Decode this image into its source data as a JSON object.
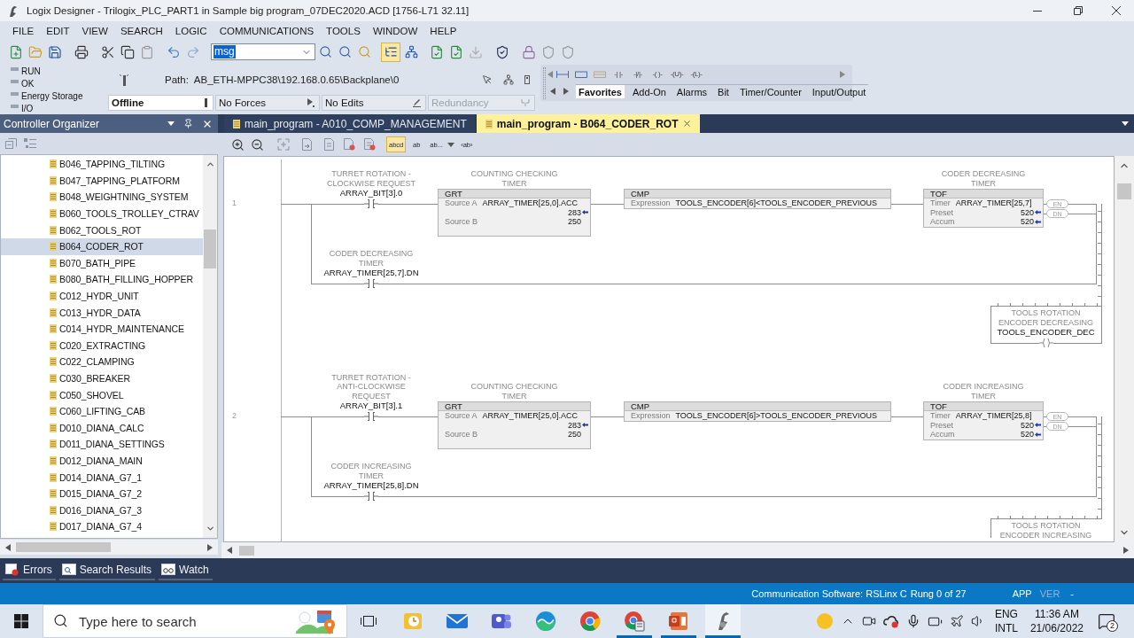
{
  "window": {
    "title": "Logix Designer - Trilogix_PLC_PART1 in Sample big program_07DEC2020.ACD [1756-L71 32.11]"
  },
  "menu": [
    "FILE",
    "EDIT",
    "VIEW",
    "SEARCH",
    "LOGIC",
    "COMMUNICATIONS",
    "TOOLS",
    "WINDOW",
    "HELP"
  ],
  "toolbar": {
    "search": {
      "value": "msg",
      "highlighted": true
    },
    "view_toggles": [
      {
        "selected": true
      },
      {
        "selected": false
      }
    ]
  },
  "controller_status": {
    "indicators": [
      {
        "label": "RUN",
        "on": false
      },
      {
        "label": "OK",
        "on": false
      },
      {
        "label": "Energy Storage",
        "on": false
      },
      {
        "label": "I/O",
        "on": false
      }
    ],
    "path_label": "Path:",
    "path": "AB_ETH-MPPC38\\192.168.0.65\\Backplane\\0",
    "modes": [
      {
        "kind": "dropdown",
        "label": "Offline",
        "disabled": false
      },
      {
        "kind": "status",
        "label": "No Forces",
        "disabled": false
      },
      {
        "kind": "status",
        "label": "No Edits",
        "disabled": false
      },
      {
        "kind": "status",
        "label": "Redundancy",
        "disabled": true
      }
    ]
  },
  "instruction_palette": {
    "symbols": [
      "-| |-",
      "-|/|-",
      "-( )-",
      "-(U)-",
      "-(L)-"
    ],
    "tabs": [
      {
        "label": "Favorites",
        "selected": true
      },
      {
        "label": "Add-On",
        "selected": false
      },
      {
        "label": "Alarms",
        "selected": false
      },
      {
        "label": "Bit",
        "selected": false
      },
      {
        "label": "Timer/Counter",
        "selected": false
      },
      {
        "label": "Input/Output",
        "selected": false
      }
    ]
  },
  "organizer": {
    "title": "Controller Organizer",
    "items": [
      {
        "label": "B046_TAPPING_TILTING",
        "selected": false
      },
      {
        "label": "B047_TAPPING_PLATFORM",
        "selected": false
      },
      {
        "label": "B048_WEIGHTNING_SYSTEM",
        "selected": false
      },
      {
        "label": "B060_TOOLS_TROLLEY_CTRAV",
        "selected": false
      },
      {
        "label": "B062_TOOLS_ROT",
        "selected": false
      },
      {
        "label": "B064_CODER_ROT",
        "selected": true
      },
      {
        "label": "B070_BATH_PIPE",
        "selected": false
      },
      {
        "label": "B080_BATH_FILLING_HOPPER",
        "selected": false
      },
      {
        "label": "C012_HYDR_UNIT",
        "selected": false
      },
      {
        "label": "C013_HYDR_DATA",
        "selected": false
      },
      {
        "label": "C014_HYDR_MAINTENANCE",
        "selected": false
      },
      {
        "label": "C020_EXTRACTING",
        "selected": false
      },
      {
        "label": "C022_CLAMPING",
        "selected": false
      },
      {
        "label": "C030_BREAKER",
        "selected": false
      },
      {
        "label": "C050_SHOVEL",
        "selected": false
      },
      {
        "label": "C060_LIFTING_CAB",
        "selected": false
      },
      {
        "label": "D010_DIANA_CALC",
        "selected": false
      },
      {
        "label": "D011_DIANA_SETTINGS",
        "selected": false
      },
      {
        "label": "D012_DIANA_MAIN",
        "selected": false
      },
      {
        "label": "D014_DIANA_G7_1",
        "selected": false
      },
      {
        "label": "D015_DIANA_G7_2",
        "selected": false
      },
      {
        "label": "D016_DIANA_G7_3",
        "selected": false
      },
      {
        "label": "D017_DIANA_G7_4",
        "selected": false
      }
    ]
  },
  "document_tabs": [
    {
      "label": "main_program - A010_COMP_MANAGEMENT",
      "selected": false
    },
    {
      "label": "main_program - B064_CODER_ROT",
      "selected": true
    }
  ],
  "ladder_toolbar": {
    "text_buttons": [
      {
        "kind": "toggle",
        "label": "abcd",
        "selected": true
      },
      {
        "kind": "toggle",
        "label": "ab",
        "selected": false
      },
      {
        "kind": "dropdown",
        "label": "ab...",
        "selected": false
      },
      {
        "kind": "toggle",
        "label": "‹ab›",
        "selected": false
      }
    ]
  },
  "rungs": [
    {
      "number": "1",
      "input": {
        "description": "TURRET ROTATION - CLOCKWISE REQUEST",
        "tag": "ARRAY_BIT[3].0"
      },
      "instructions": [
        {
          "description": "COUNTING CHECKING TIMER",
          "mnemonic": "GRT",
          "operands": [
            {
              "label": "Source A",
              "tag": "ARRAY_TIMER[25,0].ACC",
              "value": "283",
              "live": true
            },
            {
              "label": "Source B",
              "value": "250",
              "live": false
            }
          ]
        },
        {
          "mnemonic": "CMP",
          "operands": [
            {
              "label": "Expression",
              "tag": "TOOLS_ENCODER[6]<TOOLS_ENCODER_PREVIOUS"
            }
          ]
        },
        {
          "description": "CODER DECREASING TIMER",
          "mnemonic": "TOF",
          "operands": [
            {
              "label": "Timer",
              "tag": "ARRAY_TIMER[25,7]"
            },
            {
              "label": "Preset",
              "value": "520",
              "live": true
            },
            {
              "label": "Accum",
              "value": "520",
              "live": true
            }
          ],
          "outputs": [
            "EN",
            "DN"
          ]
        }
      ],
      "branch": {
        "description": "CODER DECREASING TIMER",
        "tag": "ARRAY_TIMER[25,7].DN"
      },
      "output": {
        "description": "TOOLS ROTATION ENCODER DECREASING",
        "tag": "TOOLS_ENCODER_DEC"
      }
    },
    {
      "number": "2",
      "input": {
        "description": "TURRET ROTATION - ANTI-CLOCKWISE REQUEST",
        "tag": "ARRAY_BIT[3].1"
      },
      "instructions": [
        {
          "description": "COUNTING CHECKING TIMER",
          "mnemonic": "GRT",
          "operands": [
            {
              "label": "Source A",
              "tag": "ARRAY_TIMER[25,0].ACC",
              "value": "283",
              "live": true
            },
            {
              "label": "Source B",
              "value": "250",
              "live": false
            }
          ]
        },
        {
          "mnemonic": "CMP",
          "operands": [
            {
              "label": "Expression",
              "tag": "TOOLS_ENCODER[6]>TOOLS_ENCODER_PREVIOUS"
            }
          ]
        },
        {
          "description": "CODER INCREASING TIMER",
          "mnemonic": "TOF",
          "operands": [
            {
              "label": "Timer",
              "tag": "ARRAY_TIMER[25,8]"
            },
            {
              "label": "Preset",
              "value": "520",
              "live": true
            },
            {
              "label": "Accum",
              "value": "520",
              "live": true
            }
          ],
          "outputs": [
            "EN",
            "DN"
          ]
        }
      ],
      "branch": {
        "description": "CODER INCREASING TIMER",
        "tag": "ARRAY_TIMER[25,8].DN"
      },
      "output": {
        "description": "TOOLS ROTATION ENCODER INCREASING"
      }
    }
  ],
  "output_tabs": [
    "Errors",
    "Search Results",
    "Watch"
  ],
  "status_bar": [
    {
      "text": "Communication Software: RSLinx C",
      "disabled": false
    },
    {
      "text": "Rung 0 of 27",
      "disabled": false
    },
    {
      "text": "APP",
      "disabled": false
    },
    {
      "text": "VER",
      "disabled": true
    },
    {
      "text": "-",
      "disabled": false
    }
  ],
  "taskbar": {
    "search_placeholder": "Type here to search",
    "apps": [
      {
        "running": false,
        "active": false
      },
      {
        "running": false,
        "active": false
      },
      {
        "running": false,
        "active": false
      },
      {
        "running": false,
        "active": false
      },
      {
        "running": false,
        "active": false
      },
      {
        "running": true,
        "active": false
      },
      {
        "running": true,
        "active": false
      },
      {
        "running": true,
        "active": true
      }
    ],
    "language": "ENG",
    "keyboard": "INTL",
    "time": "11:36 AM",
    "date": "21/06/2022",
    "notifications": "2"
  }
}
